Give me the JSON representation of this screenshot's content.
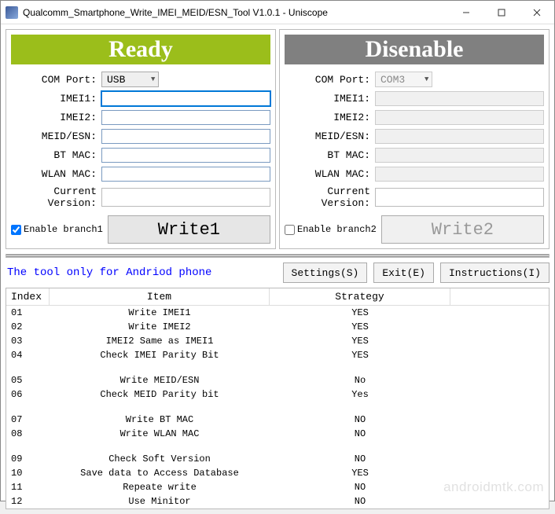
{
  "window": {
    "title": "Qualcomm_Smartphone_Write_IMEI_MEID/ESN_Tool V1.0.1  - Uniscope"
  },
  "labels": {
    "com_port": "COM Port:",
    "imei1": "IMEI1:",
    "imei2": "IMEI2:",
    "meid_esn": "MEID/ESN:",
    "bt_mac": "BT MAC:",
    "wlan_mac": "WLAN MAC:",
    "current_version": "Current Version:"
  },
  "panel1": {
    "status": "Ready",
    "com_port": "USB",
    "imei1": "",
    "imei2": "",
    "meid_esn": "",
    "bt_mac": "",
    "wlan_mac": "",
    "current_version": "",
    "enable_label": "Enable branch1",
    "enable_checked": true,
    "write_label": "Write1"
  },
  "panel2": {
    "status": "Disenable",
    "com_port": "COM3",
    "imei1": "",
    "imei2": "",
    "meid_esn": "",
    "bt_mac": "",
    "wlan_mac": "",
    "current_version": "",
    "enable_label": "Enable branch2",
    "enable_checked": false,
    "write_label": "Write2"
  },
  "note": "The tool only for Andriod phone",
  "buttons": {
    "settings": "Settings(S)",
    "exit": "Exit(E)",
    "instructions": "Instructions(I)"
  },
  "table": {
    "headers": {
      "index": "Index",
      "item": "Item",
      "strategy": "Strategy"
    },
    "groups": [
      [
        {
          "index": "01",
          "item": "Write IMEI1",
          "strategy": "YES"
        },
        {
          "index": "02",
          "item": "Write IMEI2",
          "strategy": "YES"
        },
        {
          "index": "03",
          "item": "IMEI2 Same as IMEI1",
          "strategy": "YES"
        },
        {
          "index": "04",
          "item": "Check IMEI Parity Bit",
          "strategy": "YES"
        }
      ],
      [
        {
          "index": "05",
          "item": "Write MEID/ESN",
          "strategy": "No"
        },
        {
          "index": "06",
          "item": "Check MEID Parity bit",
          "strategy": "Yes"
        }
      ],
      [
        {
          "index": "07",
          "item": "Write BT MAC",
          "strategy": "NO"
        },
        {
          "index": "08",
          "item": "Write WLAN MAC",
          "strategy": "NO"
        }
      ],
      [
        {
          "index": "09",
          "item": "Check Soft Version",
          "strategy": "NO"
        },
        {
          "index": "10",
          "item": "Save data to Access Database",
          "strategy": "YES"
        },
        {
          "index": "11",
          "item": "Repeate write",
          "strategy": "NO"
        },
        {
          "index": "12",
          "item": "Use Minitor",
          "strategy": "NO"
        }
      ]
    ]
  },
  "watermark": "androidmtk.com"
}
